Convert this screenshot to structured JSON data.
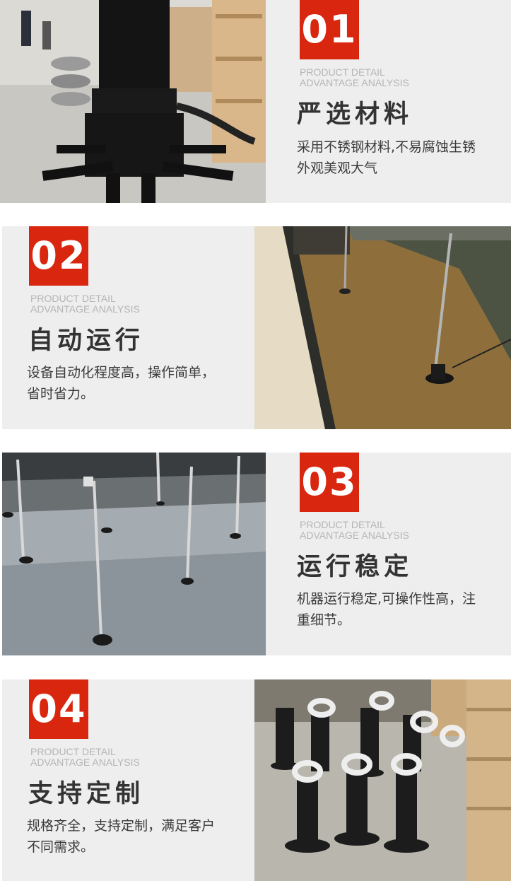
{
  "colors": {
    "accent": "#d9260f",
    "panel": "#eeeeee",
    "title": "#333333",
    "subtitle": "#b5b5b5"
  },
  "sections": [
    {
      "number": "01",
      "subtitle_line1": "PRODUCT DETAIL",
      "subtitle_line2": "ADVANTAGE ANALYSIS",
      "title": "严选材料",
      "desc_line1": "采用不锈钢材料,不易腐蚀生锈",
      "desc_line2": "外观美观大气"
    },
    {
      "number": "02",
      "subtitle_line1": "PRODUCT DETAIL",
      "subtitle_line2": "ADVANTAGE ANALYSIS",
      "title": "自动运行",
      "desc_line1": "设备自动化程度高，操作简单，",
      "desc_line2": "省时省力。"
    },
    {
      "number": "03",
      "subtitle_line1": "PRODUCT DETAIL",
      "subtitle_line2": "ADVANTAGE ANALYSIS",
      "title": "运行稳定",
      "desc_line1": "机器运行稳定,可操作性高，注",
      "desc_line2": "重细节。"
    },
    {
      "number": "04",
      "subtitle_line1": "PRODUCT DETAIL",
      "subtitle_line2": "ADVANTAGE ANALYSIS",
      "title": "支持定制",
      "desc_line1": "规格齐全，支持定制，满足客户",
      "desc_line2": "不同需求。"
    }
  ]
}
